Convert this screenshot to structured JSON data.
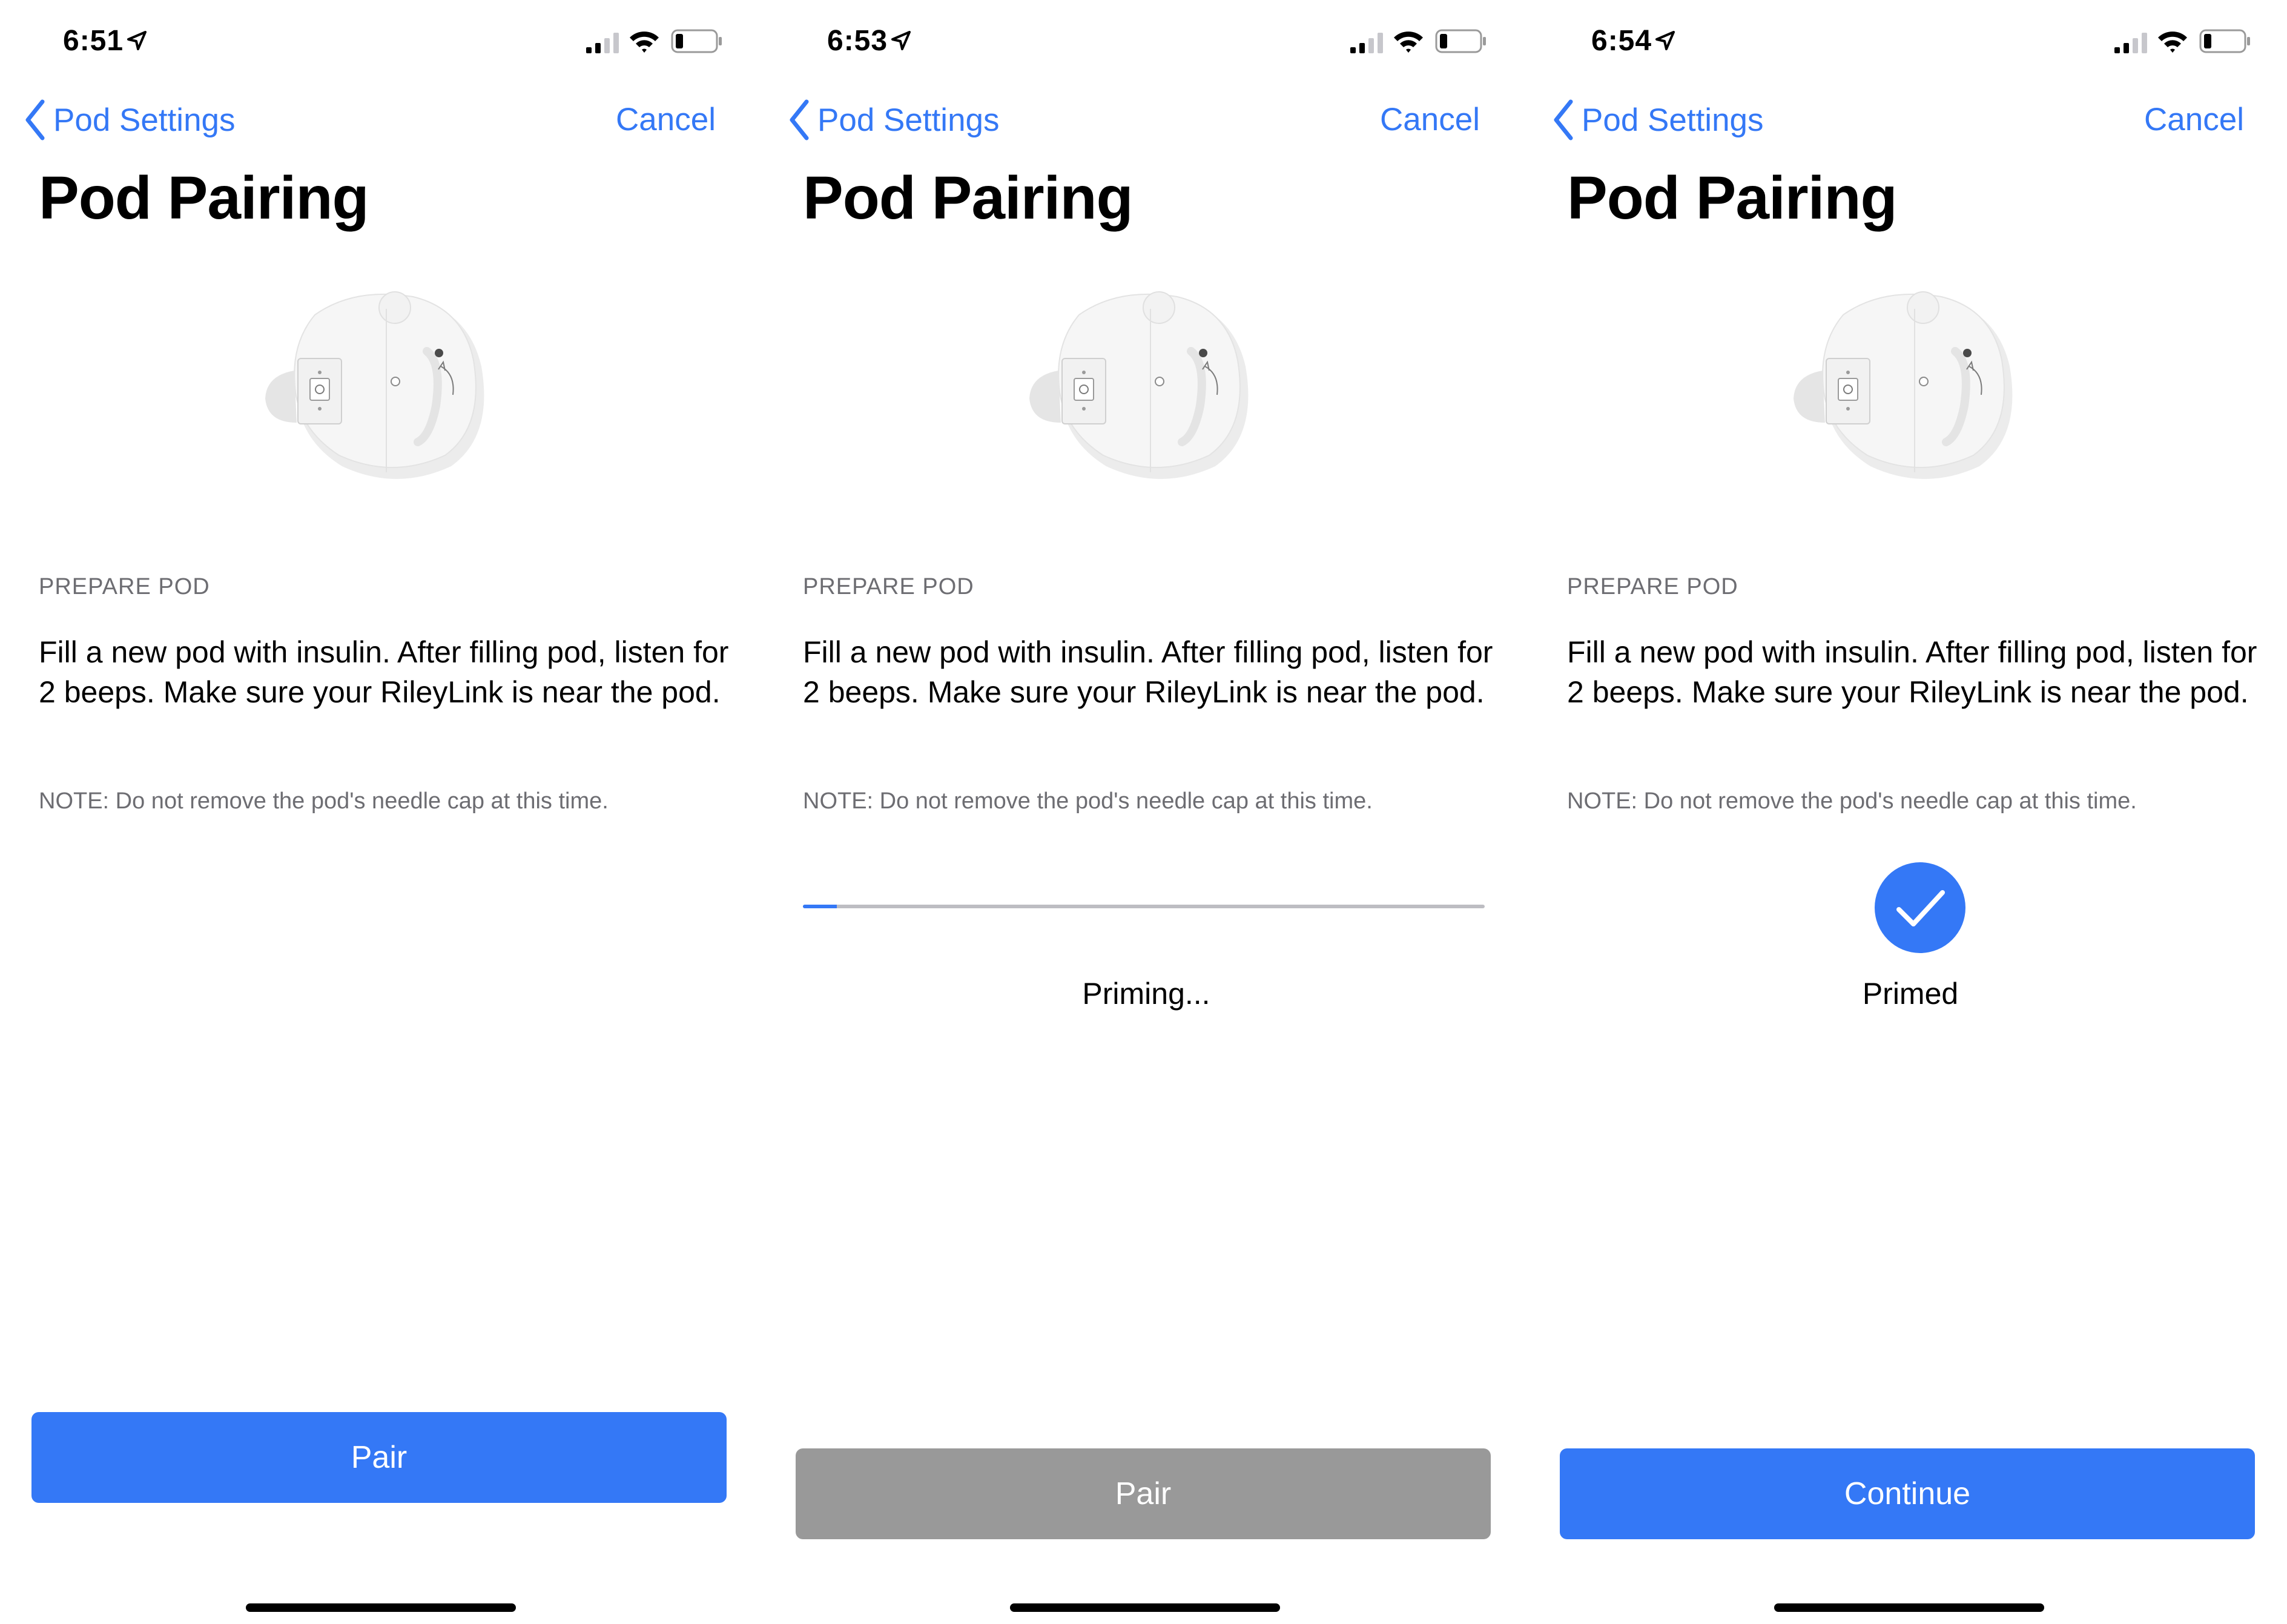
{
  "colors": {
    "accent": "#3478f6",
    "secondary_text": "#6d6d72",
    "disabled_button": "#999999"
  },
  "screens": [
    {
      "status_bar": {
        "time": "6:51",
        "icons": [
          "location-arrow-icon",
          "cellular-signal-icon",
          "wifi-icon",
          "battery-icon"
        ]
      },
      "nav": {
        "back_label": "Pod Settings",
        "cancel_label": "Cancel"
      },
      "title": "Pod Pairing",
      "section_header": "PREPARE POD",
      "instructions": "Fill a new pod with insulin. After filling pod, listen for 2 beeps. Make sure your RileyLink is near the pod.",
      "note": "NOTE: Do not remove the pod's needle cap at this time.",
      "button": {
        "label": "Pair",
        "enabled": true
      }
    },
    {
      "status_bar": {
        "time": "6:53",
        "icons": [
          "location-arrow-icon",
          "cellular-signal-icon",
          "wifi-icon",
          "battery-icon"
        ]
      },
      "nav": {
        "back_label": "Pod Settings",
        "cancel_label": "Cancel"
      },
      "title": "Pod Pairing",
      "section_header": "PREPARE POD",
      "instructions": "Fill a new pod with insulin. After filling pod, listen for 2 beeps. Make sure your RileyLink is near the pod.",
      "note": "NOTE: Do not remove the pod's needle cap at this time.",
      "progress": {
        "fraction": 0.05
      },
      "status": "Priming...",
      "button": {
        "label": "Pair",
        "enabled": false
      }
    },
    {
      "status_bar": {
        "time": "6:54",
        "icons": [
          "location-arrow-icon",
          "cellular-signal-icon",
          "wifi-icon",
          "battery-icon"
        ]
      },
      "nav": {
        "back_label": "Pod Settings",
        "cancel_label": "Cancel"
      },
      "title": "Pod Pairing",
      "section_header": "PREPARE POD",
      "instructions": "Fill a new pod with insulin. After filling pod, listen for 2 beeps. Make sure your RileyLink is near the pod.",
      "note": "NOTE: Do not remove the pod's needle cap at this time.",
      "status": "Primed",
      "status_icon": "checkmark-circle-icon",
      "button": {
        "label": "Continue",
        "enabled": true
      }
    }
  ]
}
